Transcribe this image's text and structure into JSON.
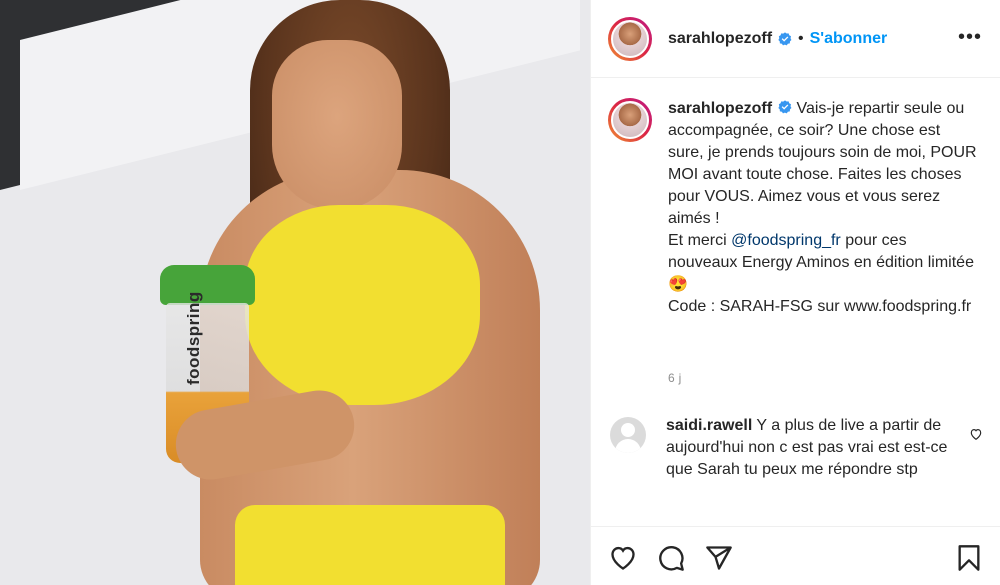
{
  "photo": {
    "brand_text": "foodspring"
  },
  "header": {
    "username": "sarahlopezoff",
    "separator": "•",
    "follow_label": "S'abonner",
    "more_label": "•••"
  },
  "caption": {
    "username": "sarahlopezoff",
    "text_part1": "Vais-je repartir seule ou accompagnée, ce soir? Une chose est sure, je prends toujours soin de moi, POUR MOI avant toute chose. Faites les choses pour VOUS. Aimez vous et vous serez aimés !\nEt merci ",
    "mention": "@foodspring_fr",
    "text_part2": " pour ces nouveaux Energy Aminos en édition limitée 😍\nCode : SARAH-FSG sur www.foodspring.fr",
    "age": "6 j"
  },
  "comment": {
    "username": "saidi.rawell",
    "text": "Y a plus de live a partir de aujourd'hui non c est pas vrai est est-ce que Sarah tu peux me répondre stp"
  },
  "icons": {
    "verified_color": "#3897f0",
    "accent_color": "#0095f6"
  }
}
